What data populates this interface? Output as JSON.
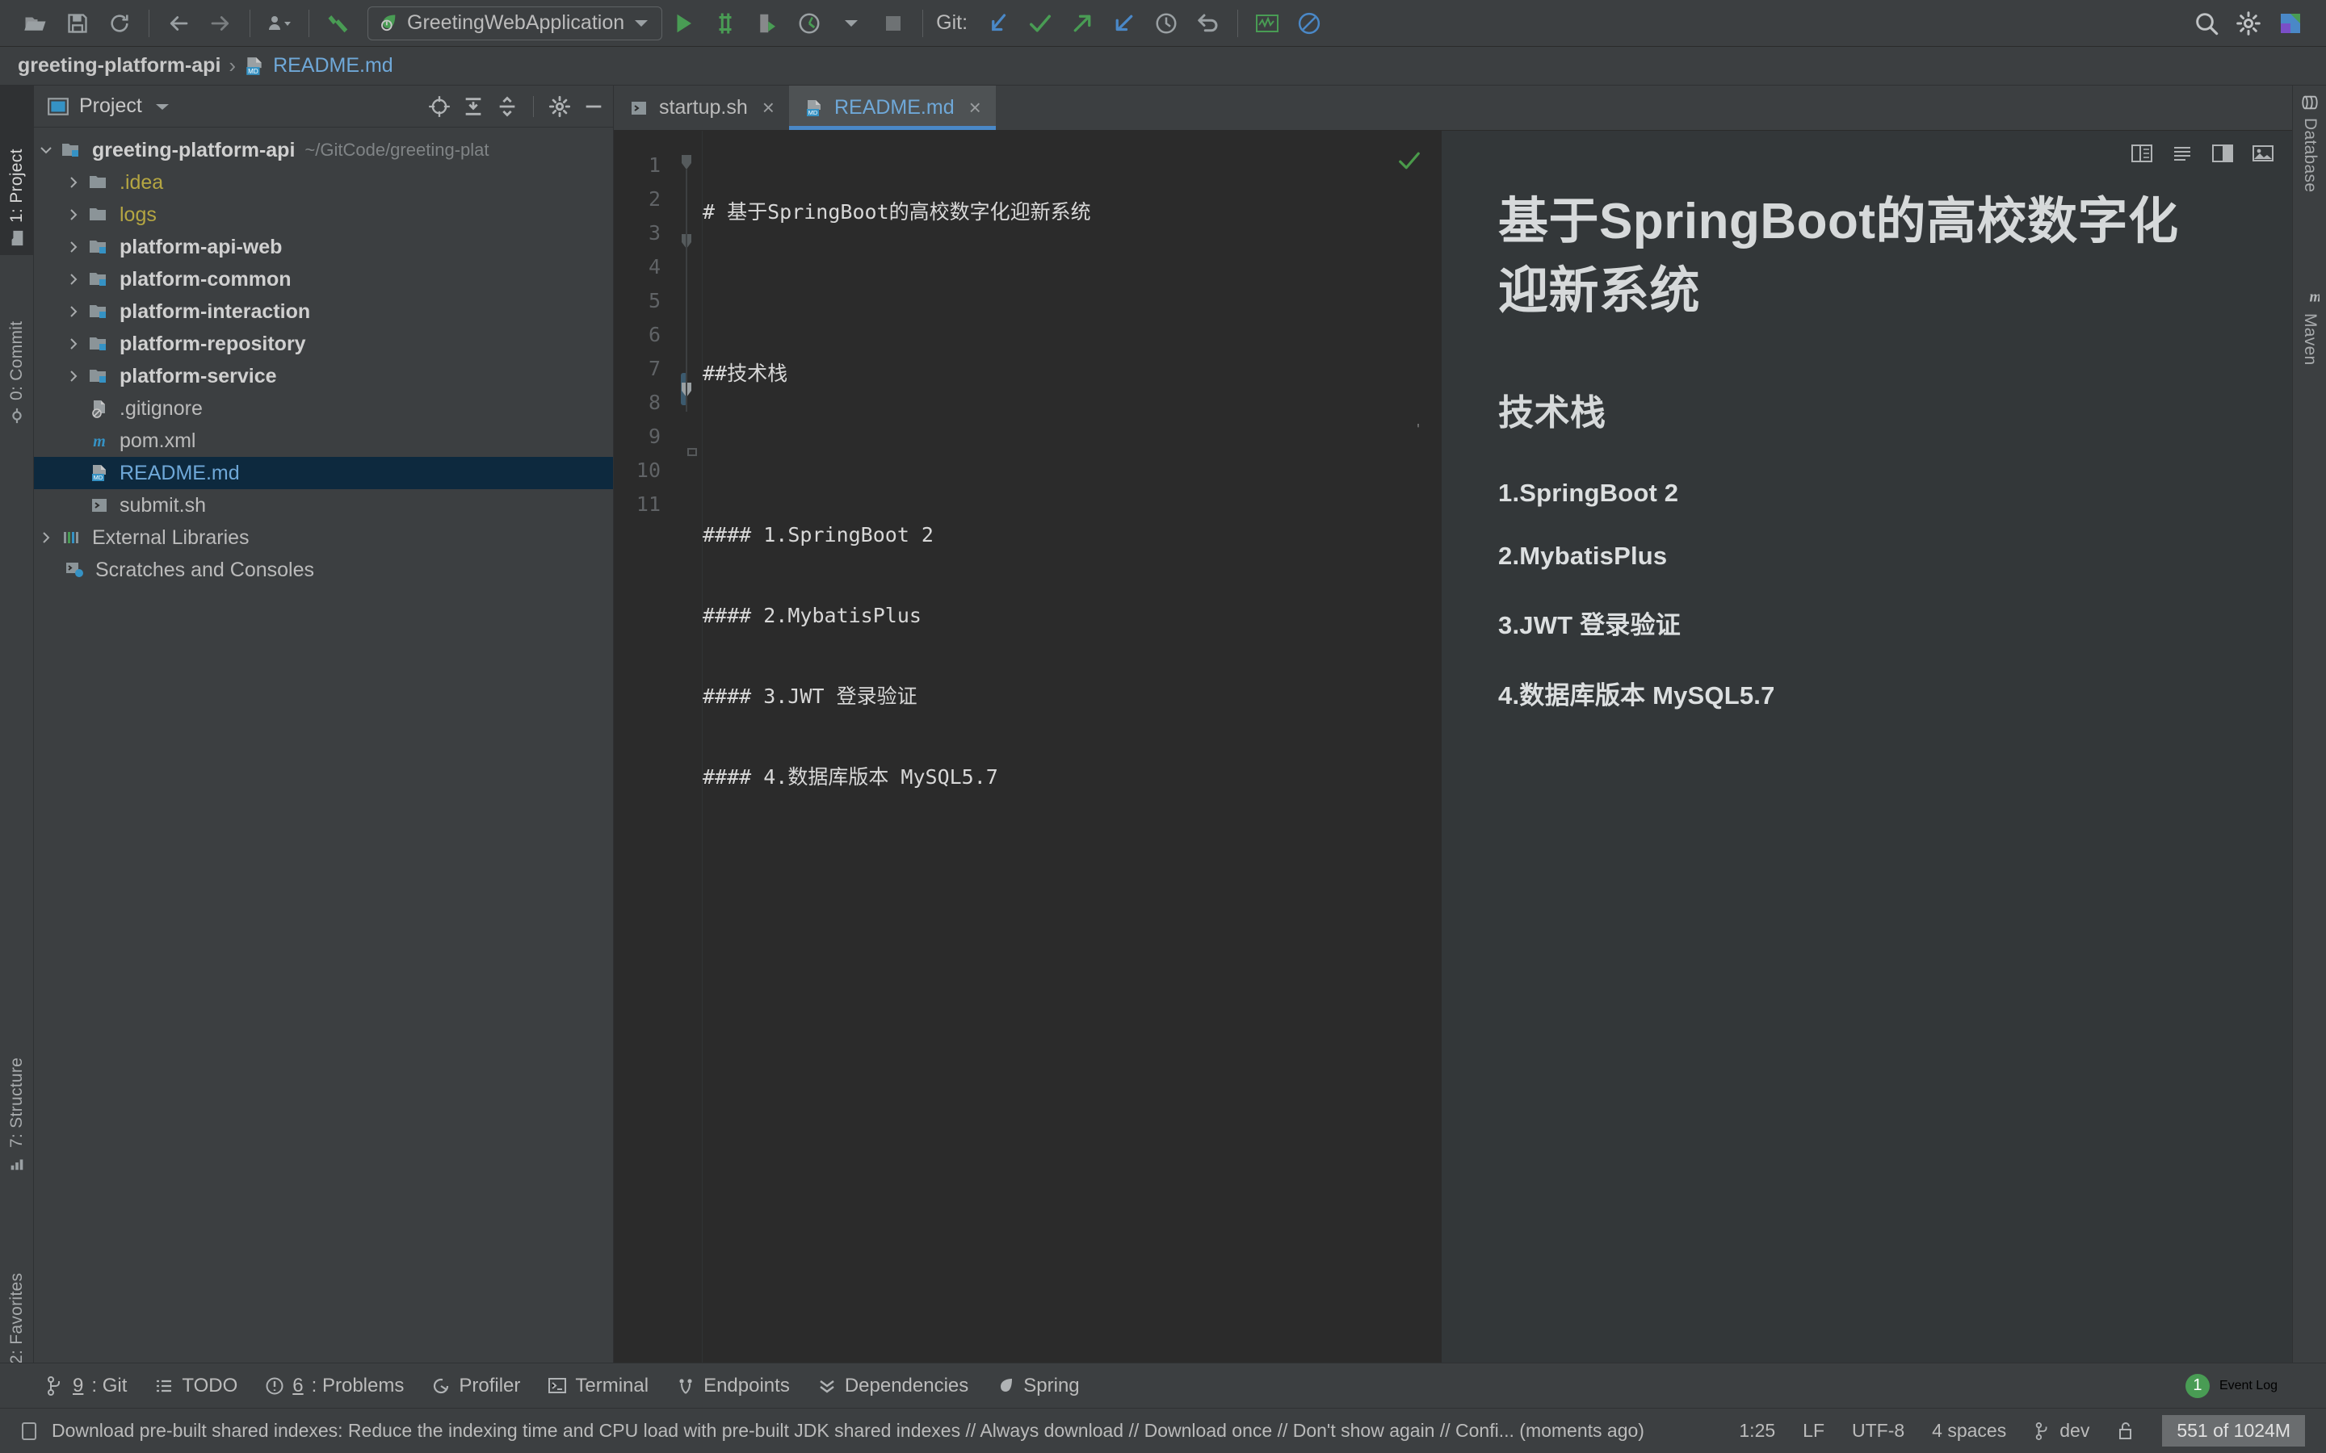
{
  "toolbar": {
    "icons": [
      "open-folder-icon",
      "save-icon",
      "sync-icon",
      "back-arrow-icon",
      "forward-arrow-icon",
      "user-dropdown-icon",
      "build-hammer-icon"
    ],
    "run_config": "GreetingWebApplication",
    "run_config_icon": "spring-boot-leaf-icon",
    "run_icon": "run-play-icon",
    "debug_icon": "debug-bug-icon",
    "run_coverage_icon": "run-with-coverage-icon",
    "profiler_icon": "profiler-clock-icon",
    "stop_icon": "stop-square-icon",
    "git_label": "Git:",
    "git_icons": [
      "update-project-icon",
      "commit-check-icon",
      "push-arrow-icon",
      "pull-arrow-icon",
      "history-clock-icon",
      "rollback-undo-icon"
    ],
    "right_icons": [
      "inspection-widget-icon",
      "no-entry-icon"
    ],
    "search_icon": "search-icon",
    "settings_icon": "gear-icon",
    "ide_icon": "ide-logo-icon"
  },
  "breadcrumb": {
    "project": "greeting-platform-api",
    "separator": "›",
    "file": "README.md",
    "file_icon": "markdown-file-icon"
  },
  "left_strip": [
    {
      "label": "1: Project",
      "icon": "project-folder-icon",
      "active": true
    },
    {
      "label": "0: Commit",
      "icon": "commit-icon",
      "active": false
    },
    {
      "label": "7: Structure",
      "icon": "structure-icon",
      "active": false
    },
    {
      "label": "2: Favorites",
      "icon": "favorites-star-icon",
      "active": false
    }
  ],
  "right_strip": [
    {
      "label": "Database",
      "icon": "database-icon"
    },
    {
      "label": "Maven",
      "icon": "maven-m-icon"
    }
  ],
  "project_panel": {
    "title": "Project",
    "title_icon": "project-window-icon",
    "dropdown_icon": "chevron-down-icon",
    "tools": [
      "locate-target-icon",
      "expand-all-icon",
      "collapse-all-icon",
      "gear-icon",
      "hide-minus-icon"
    ],
    "tree": [
      {
        "label": "greeting-platform-api",
        "path": "~/GitCode/greeting-plat",
        "icon": "module-folder-icon",
        "indent": 0,
        "twisty": "down",
        "style": "bold",
        "selected": false
      },
      {
        "label": ".idea",
        "icon": "folder-icon",
        "indent": 1,
        "twisty": "right",
        "style": "yellow",
        "selected": false
      },
      {
        "label": "logs",
        "icon": "folder-icon",
        "indent": 1,
        "twisty": "right",
        "style": "yellow",
        "selected": false
      },
      {
        "label": "platform-api-web",
        "icon": "module-folder-icon",
        "indent": 1,
        "twisty": "right",
        "style": "bold",
        "selected": false
      },
      {
        "label": "platform-common",
        "icon": "module-folder-icon",
        "indent": 1,
        "twisty": "right",
        "style": "bold",
        "selected": false
      },
      {
        "label": "platform-interaction",
        "icon": "module-folder-icon",
        "indent": 1,
        "twisty": "right",
        "style": "bold",
        "selected": false
      },
      {
        "label": "platform-repository",
        "icon": "module-folder-icon",
        "indent": 1,
        "twisty": "right",
        "style": "bold",
        "selected": false
      },
      {
        "label": "platform-service",
        "icon": "module-folder-icon",
        "indent": 1,
        "twisty": "right",
        "style": "bold",
        "selected": false
      },
      {
        "label": ".gitignore",
        "icon": "gitignore-file-icon",
        "indent": 1,
        "twisty": "none",
        "style": "plain",
        "selected": false
      },
      {
        "label": "pom.xml",
        "icon": "maven-pom-icon",
        "indent": 1,
        "twisty": "none",
        "style": "plain",
        "selected": false
      },
      {
        "label": "README.md",
        "icon": "markdown-file-icon",
        "indent": 1,
        "twisty": "none",
        "style": "blue",
        "selected": true
      },
      {
        "label": "submit.sh",
        "icon": "shell-script-icon",
        "indent": 1,
        "twisty": "none",
        "style": "plain",
        "selected": false
      },
      {
        "label": "External Libraries",
        "icon": "external-libraries-icon",
        "indent": 0,
        "twisty": "right",
        "style": "plain",
        "selected": false
      },
      {
        "label": "Scratches and Consoles",
        "icon": "scratches-icon",
        "indent": 0,
        "twisty": "none",
        "style": "plain",
        "selected": false
      }
    ]
  },
  "editor": {
    "tabs": [
      {
        "label": "startup.sh",
        "icon": "shell-script-icon",
        "active": false,
        "close": "×"
      },
      {
        "label": "README.md",
        "icon": "markdown-file-icon",
        "active": true,
        "close": "×"
      }
    ],
    "view_icons": [
      "split-view-icon",
      "editor-only-icon",
      "editor-and-preview-icon",
      "preview-only-icon"
    ],
    "inspection_ok_icon": "green-check-icon",
    "line_numbers": [
      "1",
      "2",
      "3",
      "4",
      "5",
      "6",
      "7",
      "8",
      "9",
      "10",
      "11"
    ],
    "lines": [
      "# 基于SpringBoot的高校数字化迎新系统",
      "",
      "##技术栈",
      "",
      "#### 1.SpringBoot 2",
      "#### 2.MybatisPlus",
      "#### 3.JWT 登录验证",
      "#### 4.数据库版本 MySQL5.7",
      "",
      "",
      ""
    ]
  },
  "preview": {
    "h1": "基于SpringBoot的高校数字化迎新系统",
    "h2": "技术栈",
    "items": [
      "1.SpringBoot 2",
      "2.MybatisPlus",
      "3.JWT 登录验证",
      "4.数据库版本 MySQL5.7"
    ]
  },
  "bottom_bar": {
    "items": [
      {
        "num": "9",
        "label": ": Git",
        "icon": "git-branch-icon"
      },
      {
        "num": "",
        "label": "TODO",
        "icon": "todo-list-icon"
      },
      {
        "num": "6",
        "label": ": Problems",
        "icon": "problems-warning-icon"
      },
      {
        "num": "",
        "label": "Profiler",
        "icon": "profiler-icon"
      },
      {
        "num": "",
        "label": "Terminal",
        "icon": "terminal-icon"
      },
      {
        "num": "",
        "label": "Endpoints",
        "icon": "endpoints-icon"
      },
      {
        "num": "",
        "label": "Dependencies",
        "icon": "dependencies-icon"
      },
      {
        "num": "",
        "label": "Spring",
        "icon": "spring-leaf-icon"
      }
    ],
    "event_log_count": "1",
    "event_log_label": "Event Log"
  },
  "status_bar": {
    "notification_icon": "notification-icon",
    "message": "Download pre-built shared indexes: Reduce the indexing time and CPU load with pre-built JDK shared indexes // Always download // Download once // Don't show again // Confi... (moments ago)",
    "caret_position": "1:25",
    "line_separator": "LF",
    "encoding": "UTF-8",
    "indent": "4 spaces",
    "branch": "dev",
    "branch_icon": "git-branch-icon",
    "lock_icon": "unlocked-icon",
    "memory": "551 of 1024M"
  },
  "colors": {
    "accent_blue": "#4a88c7",
    "link_blue": "#6fa8d8",
    "folder_yellow": "#b5a642",
    "green": "#499c54",
    "selection": "#0d293e",
    "panel_bg": "#3c3f41",
    "editor_bg": "#2b2b2b",
    "preview_bg": "#333739"
  }
}
